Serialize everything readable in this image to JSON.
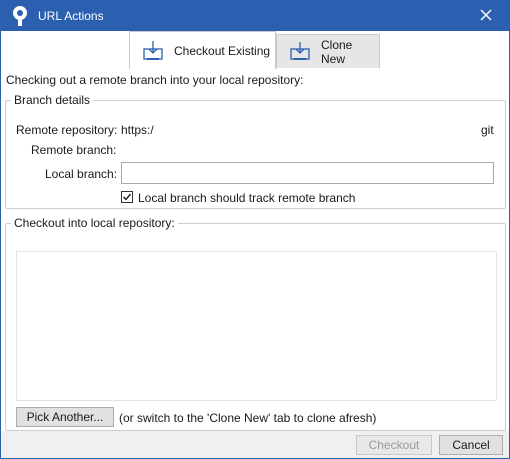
{
  "window": {
    "title": "URL Actions",
    "accent_color": "#2b5fb0"
  },
  "titlebar_icons": {
    "app": "sourcetree-icon",
    "close": "close-icon"
  },
  "tabs": [
    {
      "label": "Checkout Existing",
      "icon": "checkout-icon",
      "active": true
    },
    {
      "label": "Clone New",
      "icon": "clone-icon",
      "active": false
    }
  ],
  "description": "Checking out a remote branch into your local repository:",
  "branch_details": {
    "legend": "Branch details",
    "remote_repository_label": "Remote repository:",
    "remote_repository_value_start": "https:/",
    "remote_repository_value_end": "git",
    "remote_branch_label": "Remote branch:",
    "local_branch_label": "Local branch:",
    "local_branch_value": "",
    "track_checkbox_label": "Local branch should track remote branch",
    "track_checked": true
  },
  "checkout_into": {
    "legend": "Checkout into local repository:",
    "pick_button": "Pick Another...",
    "hint": "(or switch to the 'Clone New' tab to clone afresh)"
  },
  "footer": {
    "checkout_button": "Checkout",
    "cancel_button": "Cancel"
  }
}
